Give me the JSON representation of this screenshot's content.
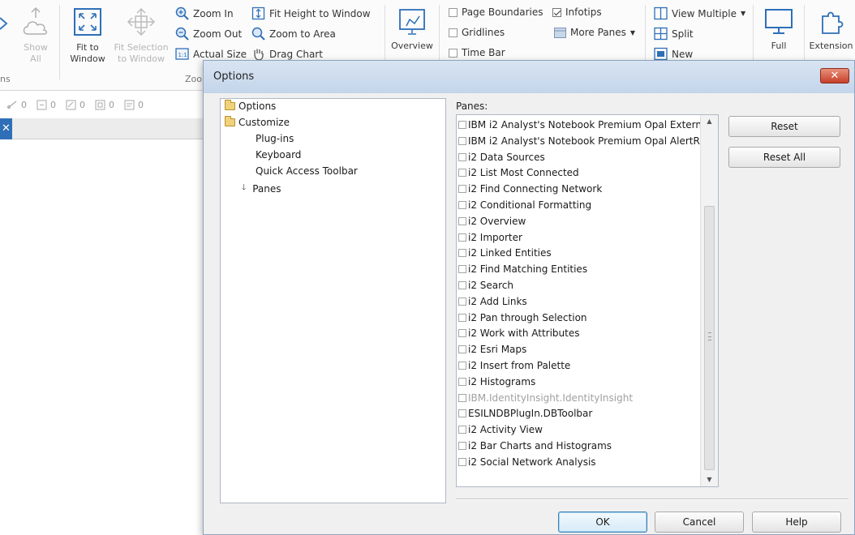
{
  "ribbon": {
    "show_all": [
      "Show",
      "All"
    ],
    "fit_to_window": [
      "Fit to",
      "Window"
    ],
    "fit_selection": [
      "Fit Selection",
      "to Window"
    ],
    "zoom_in": "Zoom In",
    "zoom_out": "Zoom Out",
    "actual_size": "Actual Size",
    "fit_height": "Fit Height to Window",
    "zoom_to_area": "Zoom to Area",
    "drag_chart": "Drag Chart",
    "zoom_group_label": "Zoo",
    "left_group_label": "ns",
    "overview": "Overview",
    "page_boundaries": "Page Boundaries",
    "gridlines": "Gridlines",
    "time_bar": "Time Bar",
    "infotips": "Infotips",
    "infotips_checked": true,
    "more_panes": "More Panes",
    "view_multiple": "View Multiple",
    "split": "Split",
    "new": "New",
    "full": "Full",
    "extensions": "Extension"
  },
  "counters": [
    "0",
    "0",
    "0",
    "0",
    "0"
  ],
  "dialog": {
    "title": "Options",
    "close_glyph": "✕",
    "tree": {
      "options": "Options",
      "customize": "Customize",
      "children": [
        "Plug-ins",
        "Keyboard",
        "Quick Access Toolbar",
        "Panes"
      ],
      "selected": "Panes"
    },
    "panes_label": "Panes:",
    "panes": [
      "IBM i2 Analyst's Notebook Premium Opal Extern",
      "IBM i2 Analyst's Notebook Premium Opal AlertR",
      "i2 Data Sources",
      "i2 List Most Connected",
      "i2 Find Connecting Network",
      "i2 Conditional Formatting",
      "i2 Overview",
      "i2 Importer",
      "i2 Linked Entities",
      "i2 Find Matching Entities",
      "i2 Search",
      "i2 Add Links",
      "i2 Pan through Selection",
      "i2 Work with Attributes",
      "i2 Esri Maps",
      "i2 Insert from Palette",
      "i2 Histograms",
      "IBM.IdentityInsight.IdentityInsight",
      "ESILNDBPlugIn.DBToolbar",
      "i2 Activity View",
      "i2 Bar Charts and Histograms",
      "i2 Social Network Analysis"
    ],
    "disabled_pane": "IBM.IdentityInsight.IdentityInsight",
    "reset": "Reset",
    "reset_all": "Reset All",
    "ok": "OK",
    "cancel": "Cancel",
    "help": "Help"
  }
}
